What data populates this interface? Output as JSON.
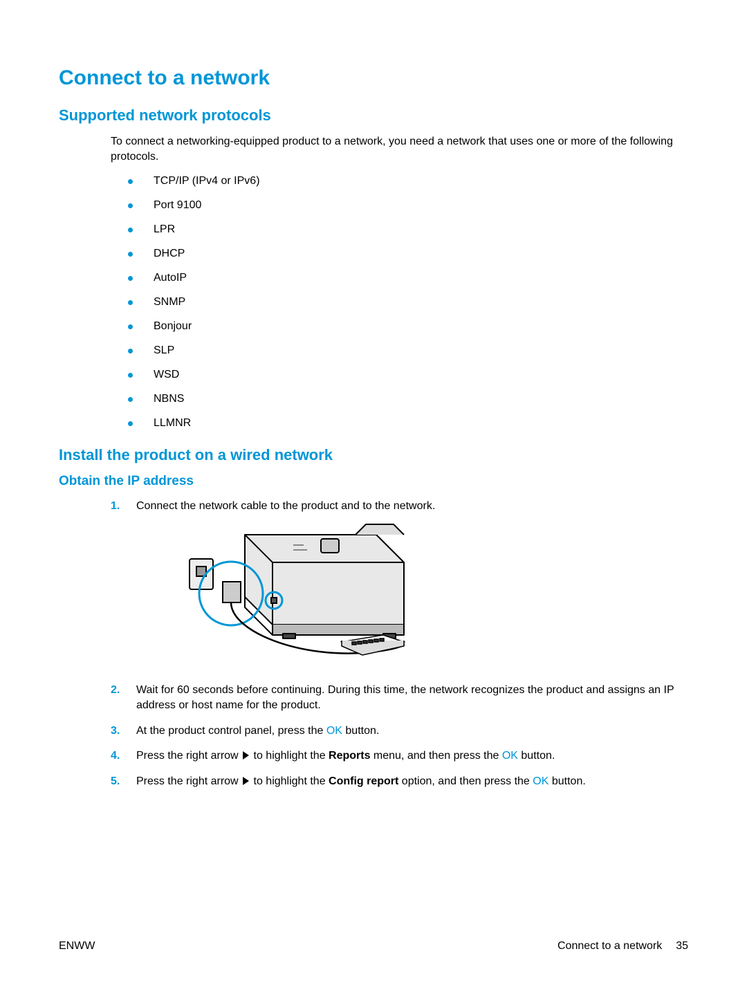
{
  "title": "Connect to a network",
  "section1": {
    "heading": "Supported network protocols",
    "intro": "To connect a networking-equipped product to a network, you need a network that uses one or more of the following protocols.",
    "protocols": [
      "TCP/IP (IPv4 or IPv6)",
      "Port 9100",
      "LPR",
      "DHCP",
      "AutoIP",
      "SNMP",
      "Bonjour",
      "SLP",
      "WSD",
      "NBNS",
      "LLMNR"
    ]
  },
  "section2": {
    "heading": "Install the product on a wired network",
    "subheading": "Obtain the IP address",
    "steps": {
      "s1": {
        "num": "1.",
        "text": "Connect the network cable to the product and to the network."
      },
      "s2": {
        "num": "2.",
        "text": "Wait for 60 seconds before continuing. During this time, the network recognizes the product and assigns an IP address or host name for the product."
      },
      "s3": {
        "num": "3.",
        "pre": "At the product control panel, press the ",
        "ok": "OK",
        "post": " button."
      },
      "s4": {
        "num": "4.",
        "pre": "Press the right arrow ",
        "mid1": " to highlight the ",
        "bold": "Reports",
        "mid2": " menu, and then press the ",
        "ok": "OK",
        "post": " button."
      },
      "s5": {
        "num": "5.",
        "pre": "Press the right arrow ",
        "mid1": " to highlight the ",
        "bold": "Config report",
        "mid2": " option, and then press the ",
        "ok": "OK",
        "post": " button."
      }
    }
  },
  "footer": {
    "left": "ENWW",
    "right_label": "Connect to a network",
    "page": "35"
  }
}
